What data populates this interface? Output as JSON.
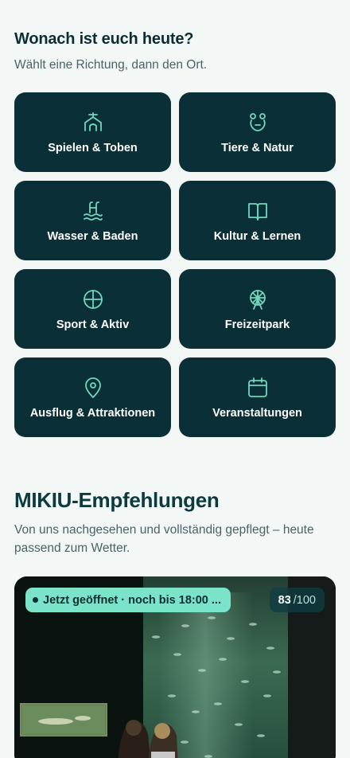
{
  "question": {
    "title": "Wonach ist euch heute?",
    "subtitle": "Wählt eine Richtung, dann den Ort."
  },
  "categories": [
    {
      "label": "Spielen & Toben",
      "icon": "playground-icon"
    },
    {
      "label": "Tiere & Natur",
      "icon": "animal-icon"
    },
    {
      "label": "Wasser & Baden",
      "icon": "pool-icon"
    },
    {
      "label": "Kultur & Lernen",
      "icon": "book-icon"
    },
    {
      "label": "Sport & Aktiv",
      "icon": "ball-icon"
    },
    {
      "label": "Freizeitpark",
      "icon": "ferris-wheel-icon"
    },
    {
      "label": "Ausflug & Attraktionen",
      "icon": "map-pin-icon"
    },
    {
      "label": "Veranstaltungen",
      "icon": "calendar-icon"
    }
  ],
  "recommendations": {
    "title": "MIKIU-Empfehlungen",
    "subtitle": "Von uns nachgesehen und vollständig gepflegt – heute passend zum Wetter.",
    "card": {
      "open_badge": "Jetzt geöffnet · noch bis 18:00 ...",
      "score": "83",
      "score_max": "/100",
      "image": "aquarium-photo"
    }
  },
  "colors": {
    "background": "#f3f8f7",
    "tile": "#0b2f36",
    "accent": "#7be3c8",
    "heading": "#0b2e33",
    "muted": "#4a6266"
  }
}
